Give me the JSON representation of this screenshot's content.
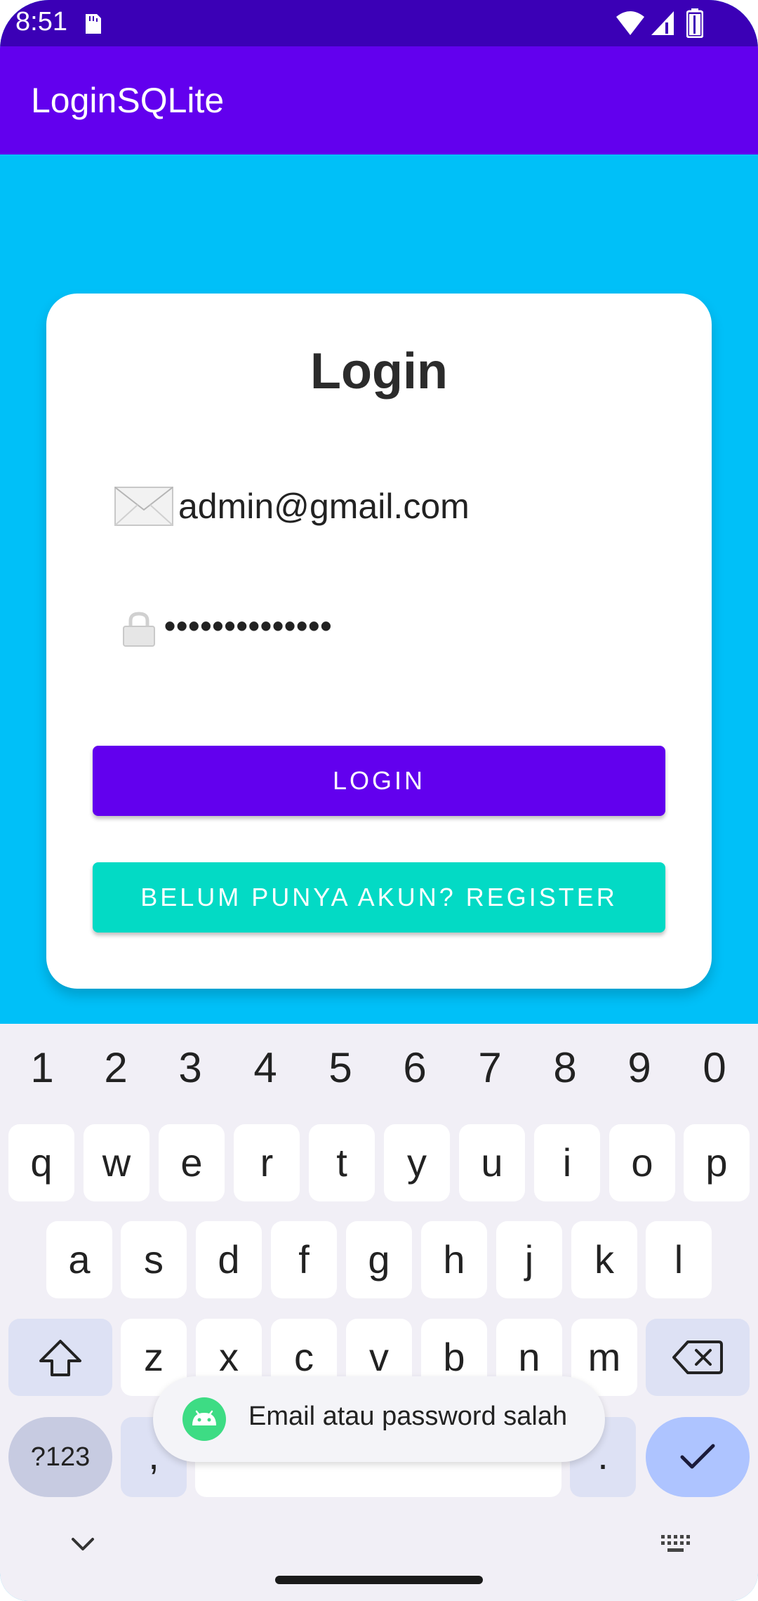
{
  "status_bar": {
    "time": "8:51"
  },
  "app_bar": {
    "title": "LoginSQLite"
  },
  "login_card": {
    "title": "Login",
    "email_value": "admin@gmail.com",
    "password_value": "••••••••••••••",
    "login_button": "LOGIN",
    "register_button": "BELUM PUNYA AKUN? REGISTER"
  },
  "keyboard": {
    "number_row": [
      "1",
      "2",
      "3",
      "4",
      "5",
      "6",
      "7",
      "8",
      "9",
      "0"
    ],
    "row1": [
      "q",
      "w",
      "e",
      "r",
      "t",
      "y",
      "u",
      "i",
      "o",
      "p"
    ],
    "row2": [
      "a",
      "s",
      "d",
      "f",
      "g",
      "h",
      "j",
      "k",
      "l"
    ],
    "row3": [
      "z",
      "x",
      "c",
      "v",
      "b",
      "n",
      "m"
    ],
    "symbols_key": "?123",
    "comma_key": ",",
    "period_key": "."
  },
  "toast": {
    "message": "Email atau password salah"
  },
  "colors": {
    "status_bar": "#3b00b6",
    "app_bar": "#6200ee",
    "background": "#00c0f8",
    "login_button": "#6200ee",
    "register_button": "#03dac5"
  }
}
